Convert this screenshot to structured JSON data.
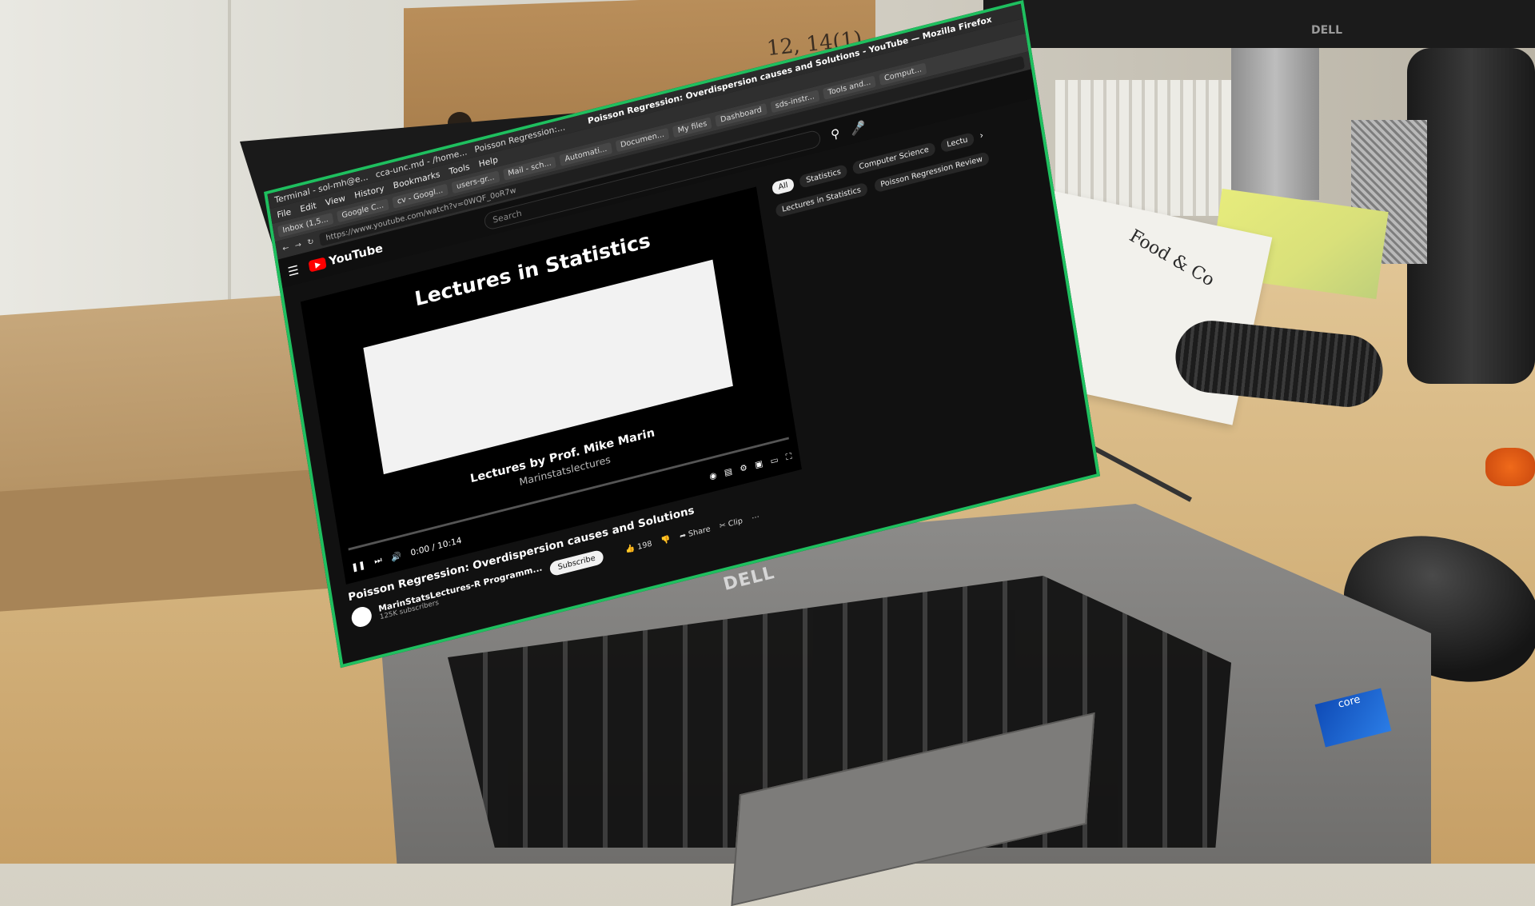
{
  "photo": {
    "box_scribble": "12, 14(1)",
    "monitor_brand": "DELL",
    "paper_text": "Food & Co",
    "laptop_brand": "DELL",
    "intel_badge": "core"
  },
  "browser": {
    "window_title": "Poisson Regression: Overdispersion causes and Solutions - YouTube — Mozilla Firefox",
    "taskbar_items": [
      "Terminal - sol-mh@e...",
      "cca-unc.md - /home...",
      "Poisson Regression:..."
    ],
    "menu": [
      "File",
      "Edit",
      "View",
      "History",
      "Bookmarks",
      "Tools",
      "Help"
    ],
    "bookmarks": [
      "Inbox (1,5...",
      "Google C...",
      "cv - Googl...",
      "users-gr...",
      "Mail - sch...",
      "Automati...",
      "Documen...",
      "My files",
      "Dashboard",
      "sds-instr...",
      "Tools and...",
      "Comput..."
    ],
    "url": "https://www.youtube.com/watch?v=0WQF_0oR7w"
  },
  "youtube": {
    "logo_text": "YouTube",
    "search_placeholder": "Search",
    "video_title_overlay": "Lectures in Statistics",
    "video_subtitle": "Lectures by Prof. Mike Marin",
    "video_channel_overlay": "Marinstatslectures",
    "time": "0:00 / 10:14",
    "progress_fraction": 0,
    "video_title": "Poisson Regression: Overdispersion causes and Solutions",
    "channel_name": "MarinStatsLectures-R Programm...",
    "subscribers": "125K subscribers",
    "subscribe_label": "Subscribe",
    "like_count": "198",
    "share_label": "Share",
    "clip_label": "Clip",
    "chips": [
      "All",
      "Statistics",
      "Computer Science",
      "Lectu"
    ],
    "chips_row2": [
      "Lectures in Statistics",
      "Poisson Regression Review"
    ]
  }
}
